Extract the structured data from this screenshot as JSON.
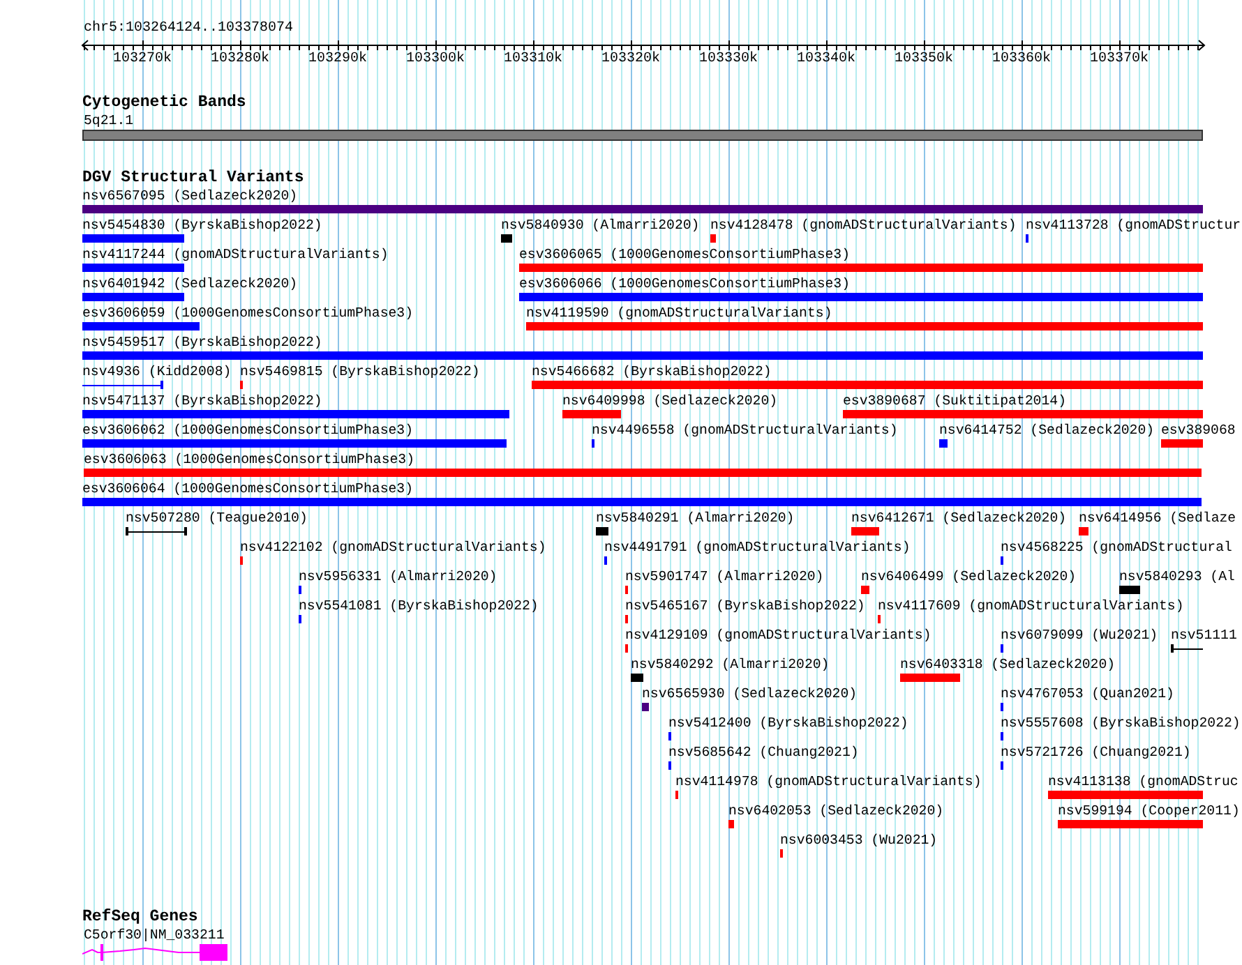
{
  "ruler": {
    "location": "chr5:103264124..103378074",
    "ticks": [
      "103270k",
      "103280k",
      "103290k",
      "103300k",
      "103310k",
      "103320k",
      "103330k",
      "103340k",
      "103350k",
      "103360k",
      "103370k"
    ]
  },
  "tracks": [
    {
      "title": "Cytogenetic Bands",
      "features": [
        {
          "label": "5q21.1",
          "kind": "band"
        }
      ]
    },
    {
      "title": "DGV Structural Variants",
      "features": [
        {
          "label": "nsv6567095 (Sedlazeck2020)",
          "kind": "bar",
          "color": "#4b0082"
        },
        {
          "label": "nsv5454830 (ByrskaBishop2022)",
          "kind": "bar",
          "color": "#0000ff"
        },
        {
          "label": "nsv5840930 (Almarri2020)",
          "kind": "bar",
          "color": "#000000"
        },
        {
          "label": "nsv4128478 (gnomADStructuralVariants)",
          "kind": "bar",
          "color": "#ff0000"
        },
        {
          "label": "nsv4113728 (gnomADStructur",
          "kind": "bar",
          "color": "#0000ff"
        },
        {
          "label": "nsv4117244 (gnomADStructuralVariants)",
          "kind": "bar",
          "color": "#0000ff"
        },
        {
          "label": "esv3606065 (1000GenomesConsortiumPhase3)",
          "kind": "bar",
          "color": "#ff0000"
        },
        {
          "label": "nsv6401942 (Sedlazeck2020)",
          "kind": "bar",
          "color": "#0000ff"
        },
        {
          "label": "esv3606066 (1000GenomesConsortiumPhase3)",
          "kind": "bar",
          "color": "#0000ff"
        },
        {
          "label": "esv3606059 (1000GenomesConsortiumPhase3)",
          "kind": "bar",
          "color": "#0000ff"
        },
        {
          "label": "nsv4119590 (gnomADStructuralVariants)",
          "kind": "bar",
          "color": "#ff0000"
        },
        {
          "label": "nsv5459517 (ByrskaBishop2022)",
          "kind": "bar",
          "color": "#0000ff"
        },
        {
          "label": "nsv4936 (Kidd2008)",
          "kind": "span",
          "color": "#0000ff"
        },
        {
          "label": "nsv5469815 (ByrskaBishop2022)",
          "kind": "bar",
          "color": "#ff0000"
        },
        {
          "label": "nsv5466682 (ByrskaBishop2022)",
          "kind": "bar",
          "color": "#ff0000"
        },
        {
          "label": "nsv5471137 (ByrskaBishop2022)",
          "kind": "bar",
          "color": "#0000ff"
        },
        {
          "label": "nsv6409998 (Sedlazeck2020)",
          "kind": "bar",
          "color": "#ff0000"
        },
        {
          "label": "esv3890687 (Suktitipat2014)",
          "kind": "bar",
          "color": "#ff0000"
        },
        {
          "label": "esv3606062 (1000GenomesConsortiumPhase3)",
          "kind": "bar",
          "color": "#0000ff"
        },
        {
          "label": "nsv4496558 (gnomADStructuralVariants)",
          "kind": "bar",
          "color": "#0000ff"
        },
        {
          "label": "nsv6414752 (Sedlazeck2020)",
          "kind": "bar",
          "color": "#0000ff"
        },
        {
          "label": "esv389068",
          "kind": "bar",
          "color": "#ff0000"
        },
        {
          "label": "esv3606063 (1000GenomesConsortiumPhase3)",
          "kind": "bar",
          "color": "#ff0000"
        },
        {
          "label": "esv3606064 (1000GenomesConsortiumPhase3)",
          "kind": "bar",
          "color": "#0000ff"
        },
        {
          "label": "nsv507280 (Teague2010)",
          "kind": "span",
          "color": "#000000"
        },
        {
          "label": "nsv5840291 (Almarri2020)",
          "kind": "bar",
          "color": "#000000"
        },
        {
          "label": "nsv6412671 (Sedlazeck2020)",
          "kind": "bar",
          "color": "#ff0000"
        },
        {
          "label": "nsv6414956 (Sedlaze",
          "kind": "bar",
          "color": "#ff0000"
        },
        {
          "label": "nsv4122102 (gnomADStructuralVariants)",
          "kind": "bar",
          "color": "#ff0000"
        },
        {
          "label": "nsv4491791 (gnomADStructuralVariants)",
          "kind": "bar",
          "color": "#0000ff"
        },
        {
          "label": "nsv4568225 (gnomADStructural",
          "kind": "bar",
          "color": "#0000ff"
        },
        {
          "label": "nsv5956331 (Almarri2020)",
          "kind": "bar",
          "color": "#0000ff"
        },
        {
          "label": "nsv5901747 (Almarri2020)",
          "kind": "bar",
          "color": "#ff0000"
        },
        {
          "label": "nsv6406499 (Sedlazeck2020)",
          "kind": "bar",
          "color": "#ff0000"
        },
        {
          "label": "nsv5840293 (Al",
          "kind": "bar",
          "color": "#000000"
        },
        {
          "label": "nsv5541081 (ByrskaBishop2022)",
          "kind": "bar",
          "color": "#0000ff"
        },
        {
          "label": "nsv5465167 (ByrskaBishop2022)",
          "kind": "bar",
          "color": "#ff0000"
        },
        {
          "label": "nsv4117609 (gnomADStructuralVariants)",
          "kind": "bar",
          "color": "#ff0000"
        },
        {
          "label": "nsv4129109 (gnomADStructuralVariants)",
          "kind": "bar",
          "color": "#ff0000"
        },
        {
          "label": "nsv6079099 (Wu2021)",
          "kind": "bar",
          "color": "#0000ff"
        },
        {
          "label": "nsv51111",
          "kind": "span",
          "color": "#000000"
        },
        {
          "label": "nsv5840292 (Almarri2020)",
          "kind": "bar",
          "color": "#000000"
        },
        {
          "label": "nsv6403318 (Sedlazeck2020)",
          "kind": "bar",
          "color": "#ff0000"
        },
        {
          "label": "nsv6565930 (Sedlazeck2020)",
          "kind": "bar",
          "color": "#4b0082"
        },
        {
          "label": "nsv4767053 (Quan2021)",
          "kind": "bar",
          "color": "#0000ff"
        },
        {
          "label": "nsv5412400 (ByrskaBishop2022)",
          "kind": "bar",
          "color": "#0000ff"
        },
        {
          "label": "nsv5557608 (ByrskaBishop2022)",
          "kind": "bar",
          "color": "#0000ff"
        },
        {
          "label": "nsv5685642 (Chuang2021)",
          "kind": "bar",
          "color": "#0000ff"
        },
        {
          "label": "nsv5721726 (Chuang2021)",
          "kind": "bar",
          "color": "#0000ff"
        },
        {
          "label": "nsv4114978 (gnomADStructuralVariants)",
          "kind": "bar",
          "color": "#ff0000"
        },
        {
          "label": "nsv4113138 (gnomADStruc",
          "kind": "bar",
          "color": "#ff0000"
        },
        {
          "label": "nsv6402053 (Sedlazeck2020)",
          "kind": "bar",
          "color": "#ff0000"
        },
        {
          "label": "nsv599194 (Cooper2011)",
          "kind": "bar",
          "color": "#ff0000"
        },
        {
          "label": "nsv6003453 (Wu2021)",
          "kind": "bar",
          "color": "#ff0000"
        }
      ]
    },
    {
      "title": "RefSeq Genes",
      "features": [
        {
          "label": "C5orf30|NM_033211",
          "kind": "gene"
        }
      ]
    }
  ]
}
